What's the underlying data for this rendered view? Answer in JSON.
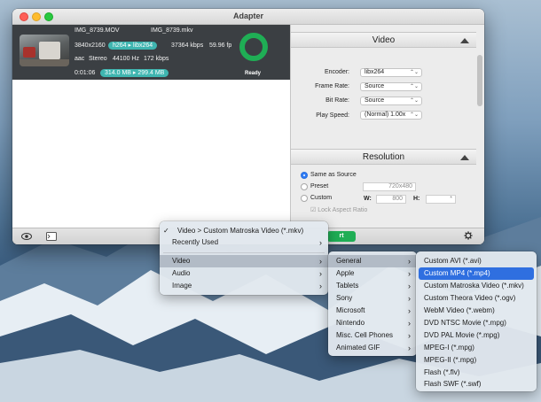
{
  "window": {
    "title": "Adapter"
  },
  "file": {
    "source_name": "IMG_8739.MOV",
    "output_name": "IMG_8739.mkv",
    "resolution": "3840x2160",
    "video_in": "h264",
    "video_out": "libx264",
    "video_bitrate": "37364 kbps",
    "fps": "59.96 fp",
    "audio_codec": "aac",
    "audio_channels": "Stereo",
    "audio_rate": "44100 Hz",
    "audio_bitrate": "172 kbps",
    "duration": "0:01:06",
    "size_in": "314.0 MB",
    "size_out": "299.4 MB",
    "status": "Ready"
  },
  "video_section": {
    "title": "Video",
    "fields": [
      {
        "label": "Encoder:",
        "value": "libx264"
      },
      {
        "label": "Frame Rate:",
        "value": "Source"
      },
      {
        "label": "Bit Rate:",
        "value": "Source"
      },
      {
        "label": "Play Speed:",
        "value": "(Normal) 1.00x"
      }
    ]
  },
  "resolution_section": {
    "title": "Resolution",
    "same_as_source": "Same as Source",
    "preset": "Preset",
    "preset_value": "720x480",
    "custom": "Custom",
    "width_label": "W:",
    "width_value": "800",
    "height_label": "H:",
    "height_value": "*",
    "lock_aspect": "Lock Aspect Ratio"
  },
  "toolbar": {
    "start_label": "rt"
  },
  "menu_main": {
    "current": "Video > Custom Matroska Video (*.mkv)",
    "recently_used": "Recently Used",
    "items": [
      "Video",
      "Audio",
      "Image"
    ]
  },
  "menu_video": {
    "items": [
      "General",
      "Apple",
      "Tablets",
      "Sony",
      "Microsoft",
      "Nintendo",
      "Misc. Cell Phones",
      "Animated GIF"
    ]
  },
  "menu_general": {
    "items": [
      "Custom AVI (*.avi)",
      "Custom MP4 (*.mp4)",
      "Custom Matroska Video (*.mkv)",
      "Custom Theora Video (*.ogv)",
      "WebM Video (*.webm)",
      "DVD NTSC Movie (*.mpg)",
      "DVD PAL Movie (*.mpg)",
      "MPEG-I (*.mpg)",
      "MPEG-II (*.mpg)",
      "Flash (*.flv)",
      "Flash SWF (*.swf)"
    ],
    "selected": "Custom MP4 (*.mp4)"
  },
  "colors": {
    "accent_teal": "#3fb5b0",
    "ready_green": "#1fae55",
    "menu_highlight": "#2f6fe0"
  }
}
